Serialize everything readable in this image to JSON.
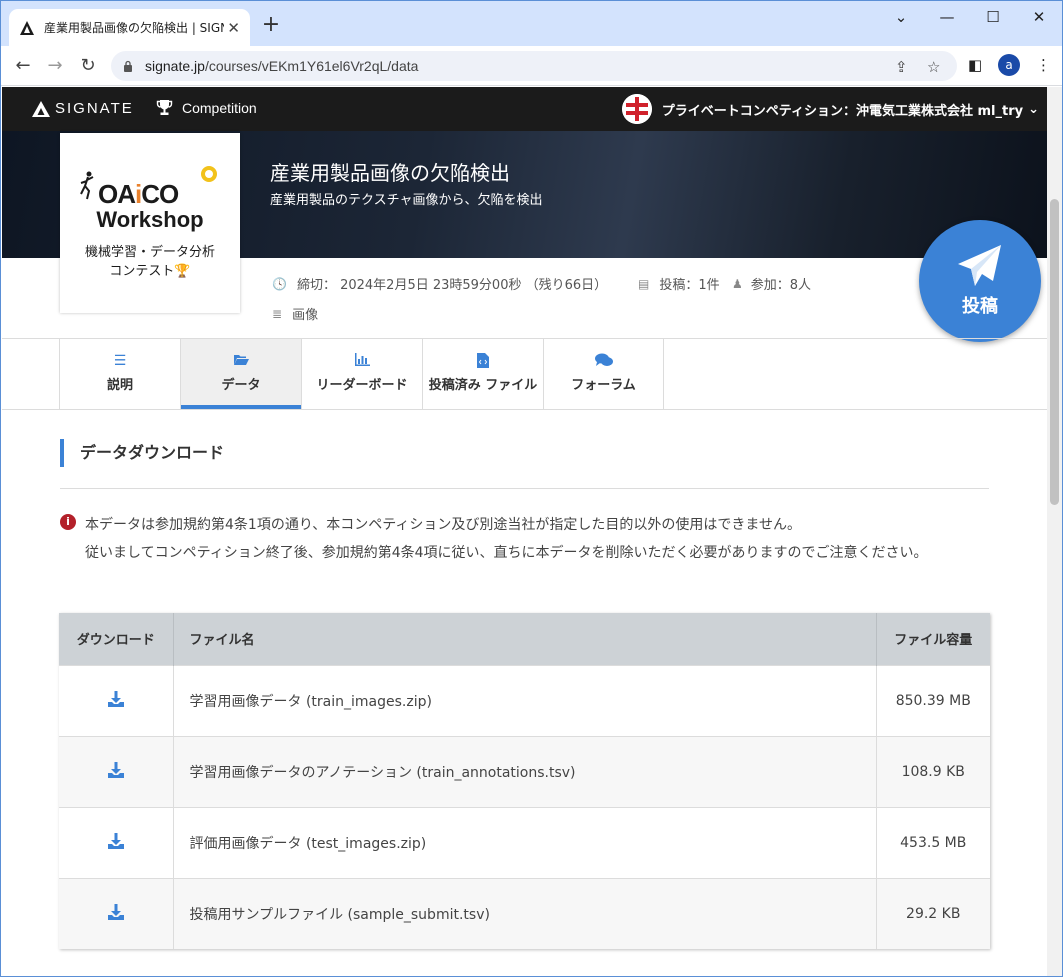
{
  "browser": {
    "tab_title": "産業用製品画像の欠陥検出 | SIGNATE",
    "url_host": "signate.jp",
    "url_path": "/courses/vEKm1Y61el6Vr2qL/data",
    "profile_initial": "a"
  },
  "nav": {
    "brand": "SIGNATE",
    "competition": "Competition",
    "org_label": "プライベートコンペティション：沖電気工業株式会社 ml_try"
  },
  "hero": {
    "title": "産業用製品画像の欠陥検出",
    "subtitle": "産業用製品のテクスチャ画像から、欠陥を検出"
  },
  "logo": {
    "oaico_pre": "OA",
    "oaico_i": "i",
    "oaico_post": "CO",
    "workshop": "Workshop",
    "line1": "機械学習・データ分析",
    "line2": "コンテスト🏆"
  },
  "meta": {
    "deadline": "締切： 2024年2月5日 23時59分00秒 （残り66日）",
    "submissions": "投稿：1件",
    "participants": "参加：8人",
    "category": "画像"
  },
  "submit_button": "投稿",
  "tabs": [
    {
      "label": "説明",
      "icon": "list-icon"
    },
    {
      "label": "データ",
      "icon": "folder-open-icon"
    },
    {
      "label": "リーダーボード",
      "icon": "bar-chart-icon"
    },
    {
      "label": "投稿済み ファイル",
      "icon": "code-file-icon"
    },
    {
      "label": "フォーラム",
      "icon": "comments-icon"
    }
  ],
  "active_tab": "データ",
  "section": {
    "title": "データダウンロード",
    "notice_line1": "本データは参加規約第4条1項の通り、本コンペティション及び別途当社が指定した目的以外の使用はできません。",
    "notice_line2": "従いましてコンペティション終了後、参加規約第4条4項に従い、直ちに本データを削除いただく必要がありますのでご注意ください。"
  },
  "table": {
    "headers": {
      "download": "ダウンロード",
      "filename": "ファイル名",
      "size": "ファイル容量"
    },
    "rows": [
      {
        "name": "学習用画像データ (train_images.zip)",
        "size": "850.39 MB"
      },
      {
        "name": "学習用画像データのアノテーション (train_annotations.tsv)",
        "size": "108.9 KB"
      },
      {
        "name": "評価用画像データ (test_images.zip)",
        "size": "453.5 MB"
      },
      {
        "name": "投稿用サンプルファイル (sample_submit.tsv)",
        "size": "29.2 KB"
      }
    ]
  },
  "colors": {
    "accent": "#3b82d6",
    "nav_bg": "#1b1b1b",
    "warning": "#b3202a"
  }
}
